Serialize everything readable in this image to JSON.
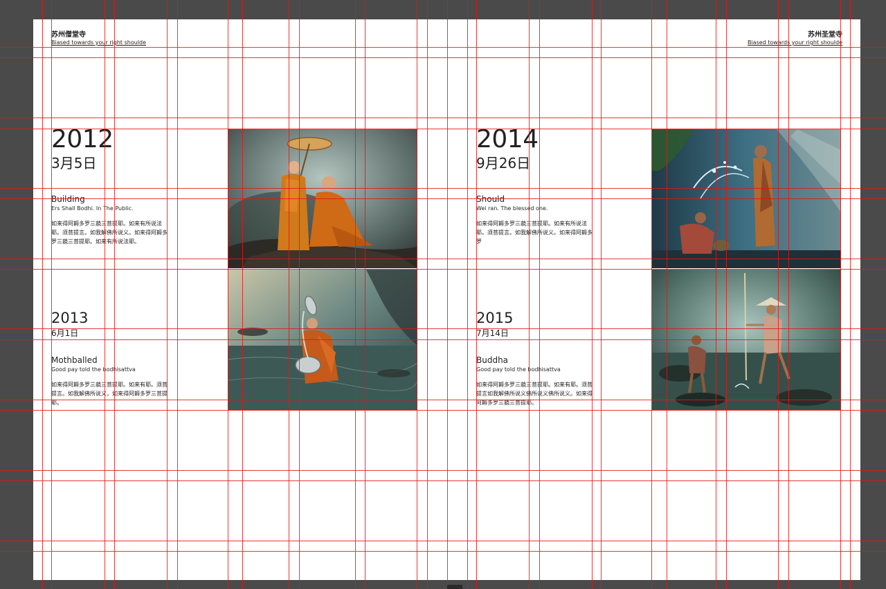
{
  "header_left": {
    "title": "苏州僧堂寺",
    "subtitle": "Biased towards your right shoulde"
  },
  "header_right": {
    "title": "苏州圣堂寺",
    "subtitle": "Biased towards your right shoulde"
  },
  "entries": [
    {
      "year": "2012",
      "date": "3月5日",
      "heading": "Building",
      "subheading": "Ers Shall Bodhi. In The Public.",
      "body": "如来得阿耨多罗三藐三菩提耶。如来有所说法耶。须菩提言。如我解佛所说义。如来得阿耨多罗三藐三菩提耶。如来有所说法耶。"
    },
    {
      "year": "2013",
      "date": "6月1日",
      "heading": "Mothballed",
      "subheading": "Good pay told the bodhisattva",
      "body": "如来得阿耨多罗三藐三菩提耶。如来有耶。须菩提言。如我解佛所说义，如来得阿耨多罗三菩提耶。"
    },
    {
      "year": "2014",
      "date": "9月26日",
      "heading": "Should",
      "subheading": "Wei ran. The blessed one.",
      "body": "如来得阿耨多罗三藐三菩提耶。如来有所说法耶。须菩提言。如我解佛所说义。如来得阿耨多罗"
    },
    {
      "year": "2015",
      "date": "7月14日",
      "heading": "Buddha",
      "subheading": "Good pay told the bodhisattva",
      "body": "如来得阿耨多罗三藐三菩提耶。如来有耶。须菩提言如我解佛所说义佛所说义佛所说义。如来得阿耨多罗三藐三菩提耶。"
    }
  ],
  "photos": [
    {
      "name": "photo-monks-umbrella",
      "subject": "two novice monks with umbrella on rock"
    },
    {
      "name": "photo-monk-bathing",
      "subject": "monk pouring water from bowl in river"
    },
    {
      "name": "photo-boys-splashing",
      "subject": "boys splashing water in stream"
    },
    {
      "name": "photo-boys-fishing",
      "subject": "boys fishing with spear in stream"
    }
  ],
  "colors": {
    "workspace": "#4a4a4a",
    "page": "#ffffff",
    "guide": "#e61414",
    "text": "#222222"
  }
}
